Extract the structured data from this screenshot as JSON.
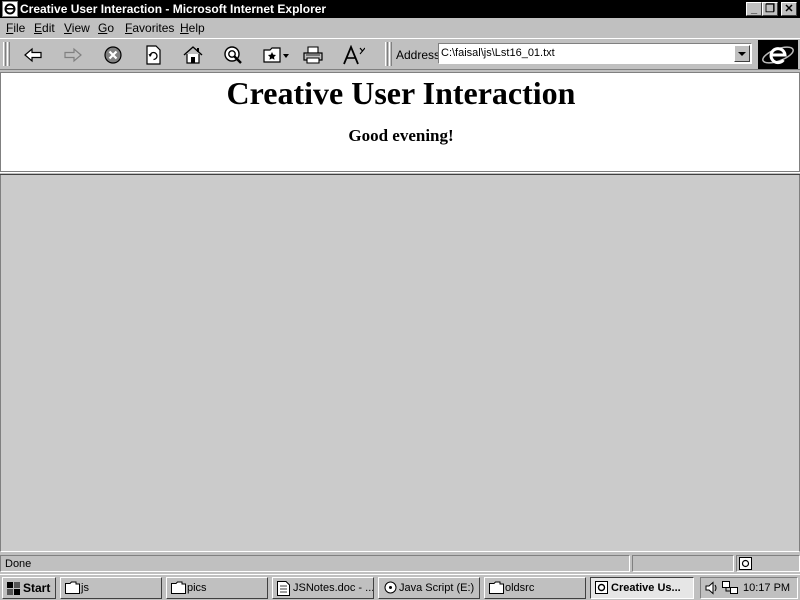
{
  "window": {
    "title": "Creative User Interaction - Microsoft Internet Explorer",
    "minimize": "_",
    "restore": "❐",
    "close": "✕"
  },
  "menu": [
    {
      "key": "F",
      "rest": "ile"
    },
    {
      "key": "E",
      "rest": "dit"
    },
    {
      "key": "V",
      "rest": "iew"
    },
    {
      "key": "G",
      "rest": "o"
    },
    {
      "key": "F",
      "rest": "avorites"
    },
    {
      "key": "H",
      "rest": "elp"
    }
  ],
  "toolbar": {
    "icons": [
      "back-icon",
      "forward-icon",
      "stop-icon",
      "refresh-icon",
      "home-icon",
      "search-icon",
      "favorites-icon",
      "print-icon",
      "font-icon"
    ],
    "address_label": "Address",
    "address_value": "C:\\faisal\\js\\Lst16_01.txt"
  },
  "page": {
    "heading": "Creative User Interaction",
    "greeting": "Good evening!"
  },
  "status": {
    "text": "Done"
  },
  "taskbar": {
    "start_label": "Start",
    "tasks": [
      {
        "label": "js",
        "icon": "folder-icon"
      },
      {
        "label": "pics",
        "icon": "folder-icon"
      },
      {
        "label": "JSNotes.doc - ...",
        "icon": "document-icon"
      },
      {
        "label": "Java Script (E:)",
        "icon": "drive-icon"
      },
      {
        "label": "oldsrc",
        "icon": "folder-icon"
      },
      {
        "label": "Creative Us...",
        "icon": "ie-icon"
      }
    ],
    "clock": "10:17 PM"
  },
  "colors": {
    "chrome": "#c0c0c0",
    "titlebar": "#000000",
    "page_background": "#ffffff",
    "frame_background": "#cbcbcb"
  }
}
